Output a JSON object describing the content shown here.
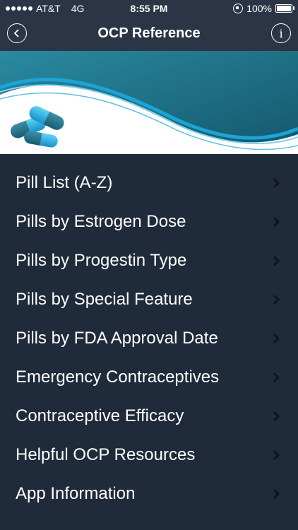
{
  "status_bar": {
    "carrier": "AT&T",
    "network": "4G",
    "time": "8:55 PM",
    "battery": "100%"
  },
  "nav": {
    "title": "OCP Reference",
    "back_icon": "back-circle-icon",
    "info_label": "i"
  },
  "menu": {
    "items": [
      {
        "label": "Pill List (A-Z)"
      },
      {
        "label": "Pills by Estrogen Dose"
      },
      {
        "label": "Pills by Progestin Type"
      },
      {
        "label": "Pills by Special Feature"
      },
      {
        "label": "Pills by FDA Approval Date"
      },
      {
        "label": "Emergency Contraceptives"
      },
      {
        "label": "Contraceptive Efficacy"
      },
      {
        "label": "Helpful OCP Resources"
      },
      {
        "label": "App Information"
      }
    ]
  },
  "colors": {
    "background": "#1f2a3a",
    "nav": "#2b3545",
    "banner_teal": "#1d6f85",
    "accent_blue": "#1ba4d8",
    "text": "#ffffff"
  }
}
